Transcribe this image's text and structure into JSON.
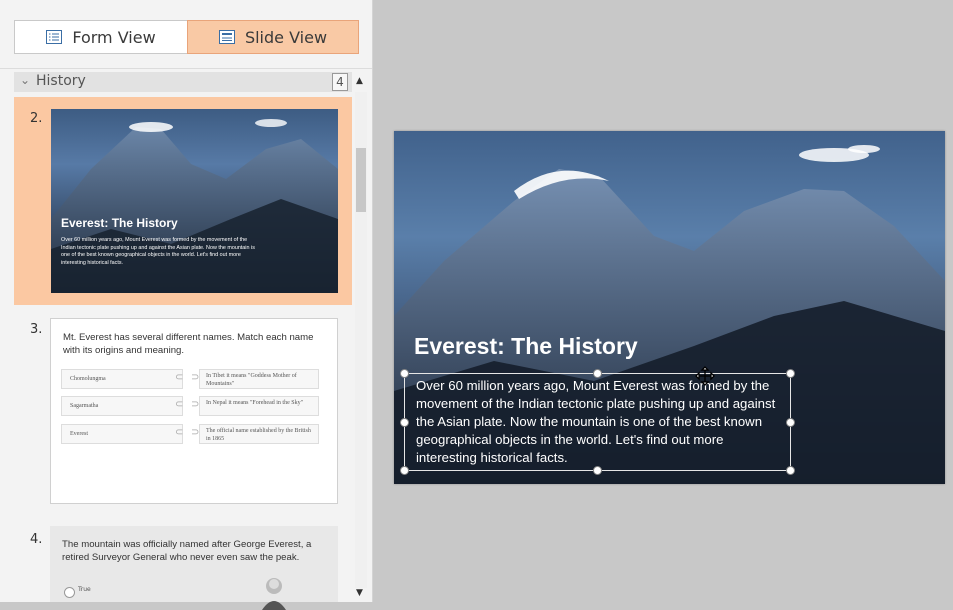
{
  "toolbar": {
    "form_view_label": "Form View",
    "slide_view_label": "Slide View"
  },
  "section": {
    "title": "History",
    "count": "4"
  },
  "slides": {
    "s2": {
      "number": "2.",
      "title": "Everest: The History",
      "body": "Over 60 million years ago, Mount Everest was formed by the movement of the Indian tectonic plate pushing up and against the Asian plate. Now the mountain is one of the best known geographical objects in the world. Let's find out more interesting historical facts."
    },
    "s3": {
      "number": "3.",
      "question": "Mt. Everest has several different names. Match each name with its origins and meaning.",
      "left_items": [
        "Chomolungma",
        "Sagarmatha",
        "Everest"
      ],
      "right_items": [
        "In Tibet it means \"Goddess Mother of Mountains\"",
        "In Nepal it means \"Forehead in the Sky\"",
        "The official name established by the British in 1865"
      ]
    },
    "s4": {
      "number": "4.",
      "question": "The mountain was officially named after George Everest, a retired Surveyor General who never even saw the peak.",
      "option_true": "True"
    }
  },
  "main_slide": {
    "title": "Everest: The History",
    "body": "Over 60 million years ago, Mount Everest was formed by the movement of the Indian tectonic plate pushing up and against the Asian plate. Now the mountain is one of the best known geographical objects in the world. Let's find out more interesting historical facts."
  },
  "colors": {
    "accent": "#f9c9a5",
    "canvas": "#c8c8c8"
  }
}
